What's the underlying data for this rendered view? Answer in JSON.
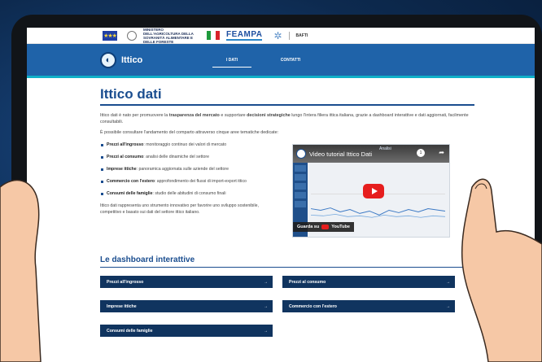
{
  "logos": {
    "eu_flag": "eu-flag-icon",
    "ministry_text": "MINISTERO DELL'AGRICOLTURA DELLA SOVRANITÀ ALIMENTARE E DELLE FORESTE",
    "feampa": "FEAMPA",
    "bafti": "BAFTI"
  },
  "nav": {
    "brand": "Ittico",
    "links": [
      "I DATI",
      "CONTATTI"
    ]
  },
  "page": {
    "title": "Ittico dati",
    "intro_1_a": "Ittico dati è nato per promuovere la ",
    "intro_1_b": "trasparenza del mercato",
    "intro_1_c": " e supportare ",
    "intro_1_d": "decisioni strategiche",
    "intro_1_e": " lungo l'intera filiera ittica italiana, grazie a dashboard interattive e dati aggiornati, facilmente consultabili.",
    "intro_2": "È possibile consultare l'andamento del comparto attraverso cinque aree tematiche dedicate:",
    "themes": [
      {
        "bold": "Prezzi all'ingrosso",
        "text": ": monitoraggio continuo dei valori di mercato"
      },
      {
        "bold": "Prezzi al consumo",
        "text": ": analisi delle dinamiche del settore"
      },
      {
        "bold": "Imprese ittiche",
        "text": ": panoramica aggiornata sulle aziende del settore"
      },
      {
        "bold": "Commercio con l'estero",
        "text": ": approfondimento dei flussi di import-export ittico"
      },
      {
        "bold": "Consumi delle famiglie",
        "text": ": studio delle abitudini di consumo finali"
      }
    ],
    "closing": "Ittico dati rappresenta uno strumento innovativo per favorire uno sviluppo sostenibile, competitivo e basato sui dati del settore ittico italiano."
  },
  "video": {
    "title": "Video tutorial Ittico Dati",
    "header_label": "Analisi",
    "counter": "1",
    "watch_on": "Guarda su",
    "youtube": "YouTube"
  },
  "dashboards": {
    "title": "Le dashboard interattive",
    "items": [
      "Prezzi all'ingrosso",
      "Prezzi al consumo",
      "Imprese ittiche",
      "Commercio con l'estero",
      "Consumi delle famiglie"
    ],
    "arrow": "→"
  },
  "colors": {
    "nav_blue": "#1f63a9",
    "title_blue": "#1a4d8f",
    "dash_button": "#10345f",
    "accent_cyan": "#10b0c8"
  }
}
